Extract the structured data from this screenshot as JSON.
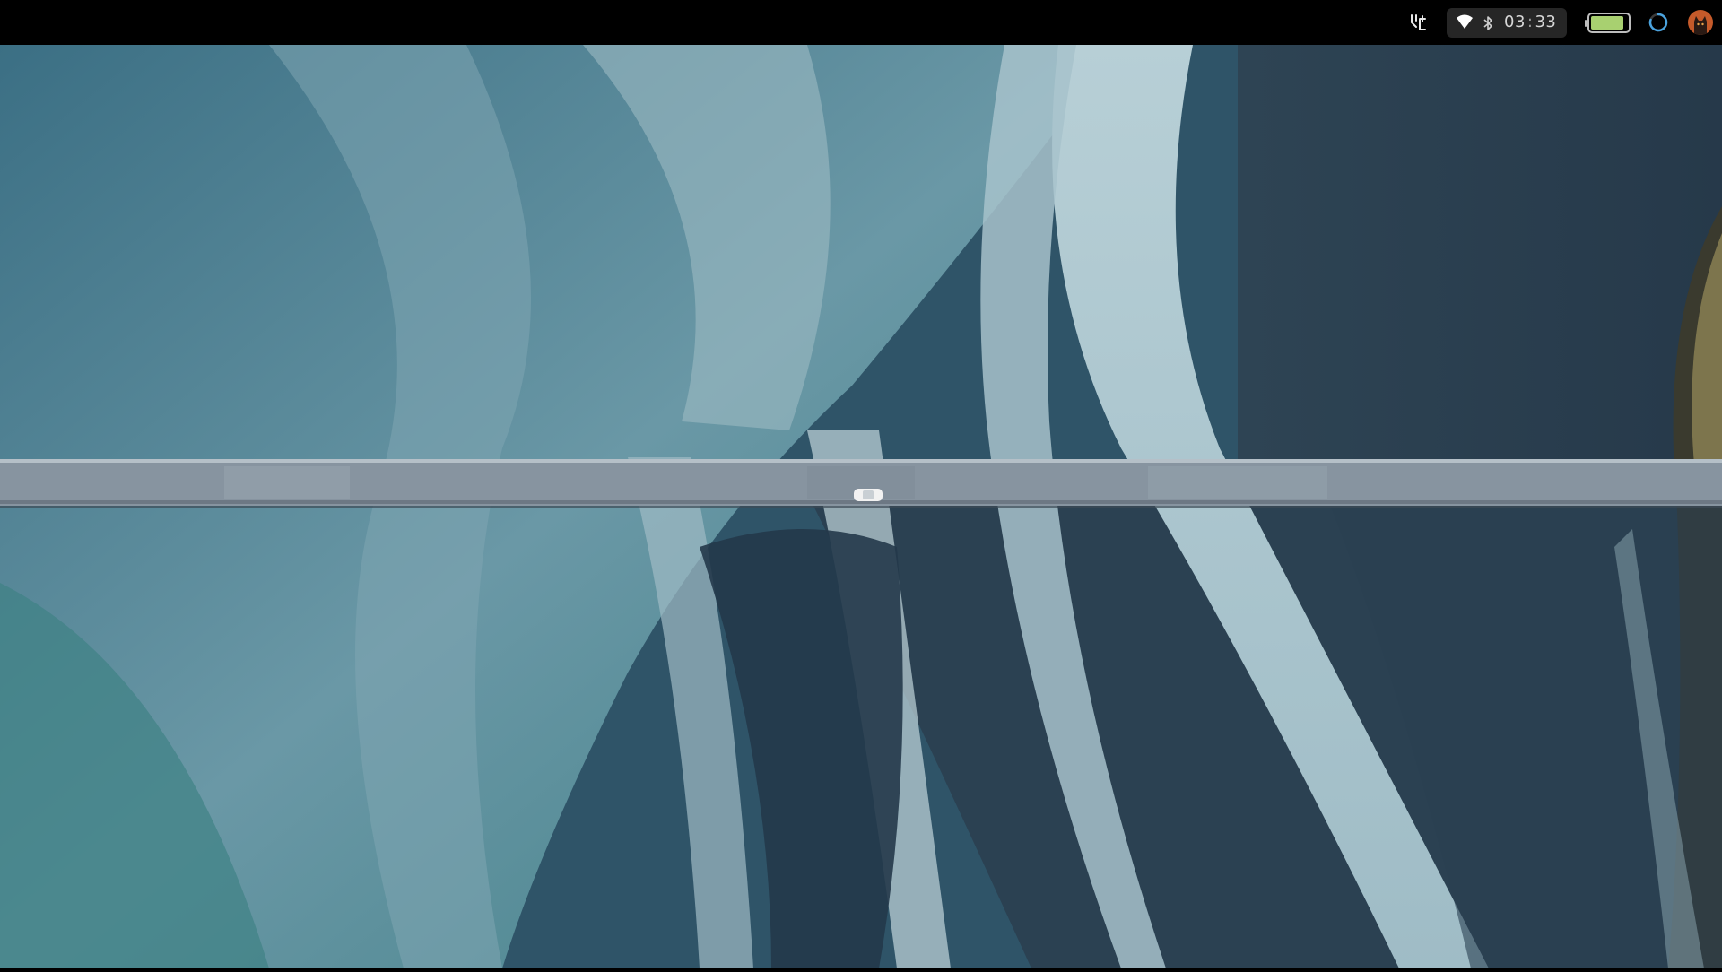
{
  "topbar": {
    "clock": {
      "hours": "03",
      "separator": ":",
      "minutes": "33"
    },
    "battery_level": 0.9,
    "battery_color": "#a8d070",
    "icons": [
      "app-indicator-icon",
      "wifi-icon",
      "bluetooth-icon",
      "battery-icon",
      "sync-spinner-icon",
      "avatar-icon"
    ]
  },
  "wallpaper": {
    "subject": "aerial-braided-river-with-bridge",
    "colors": {
      "water_light": "#a9c3cc",
      "water_mid": "#5f8b9b",
      "water_teal": "#3f7f86",
      "gravel_dark": "#2c3d4b",
      "bridge": "#8e9aa6",
      "grass": "#8f8455"
    }
  }
}
